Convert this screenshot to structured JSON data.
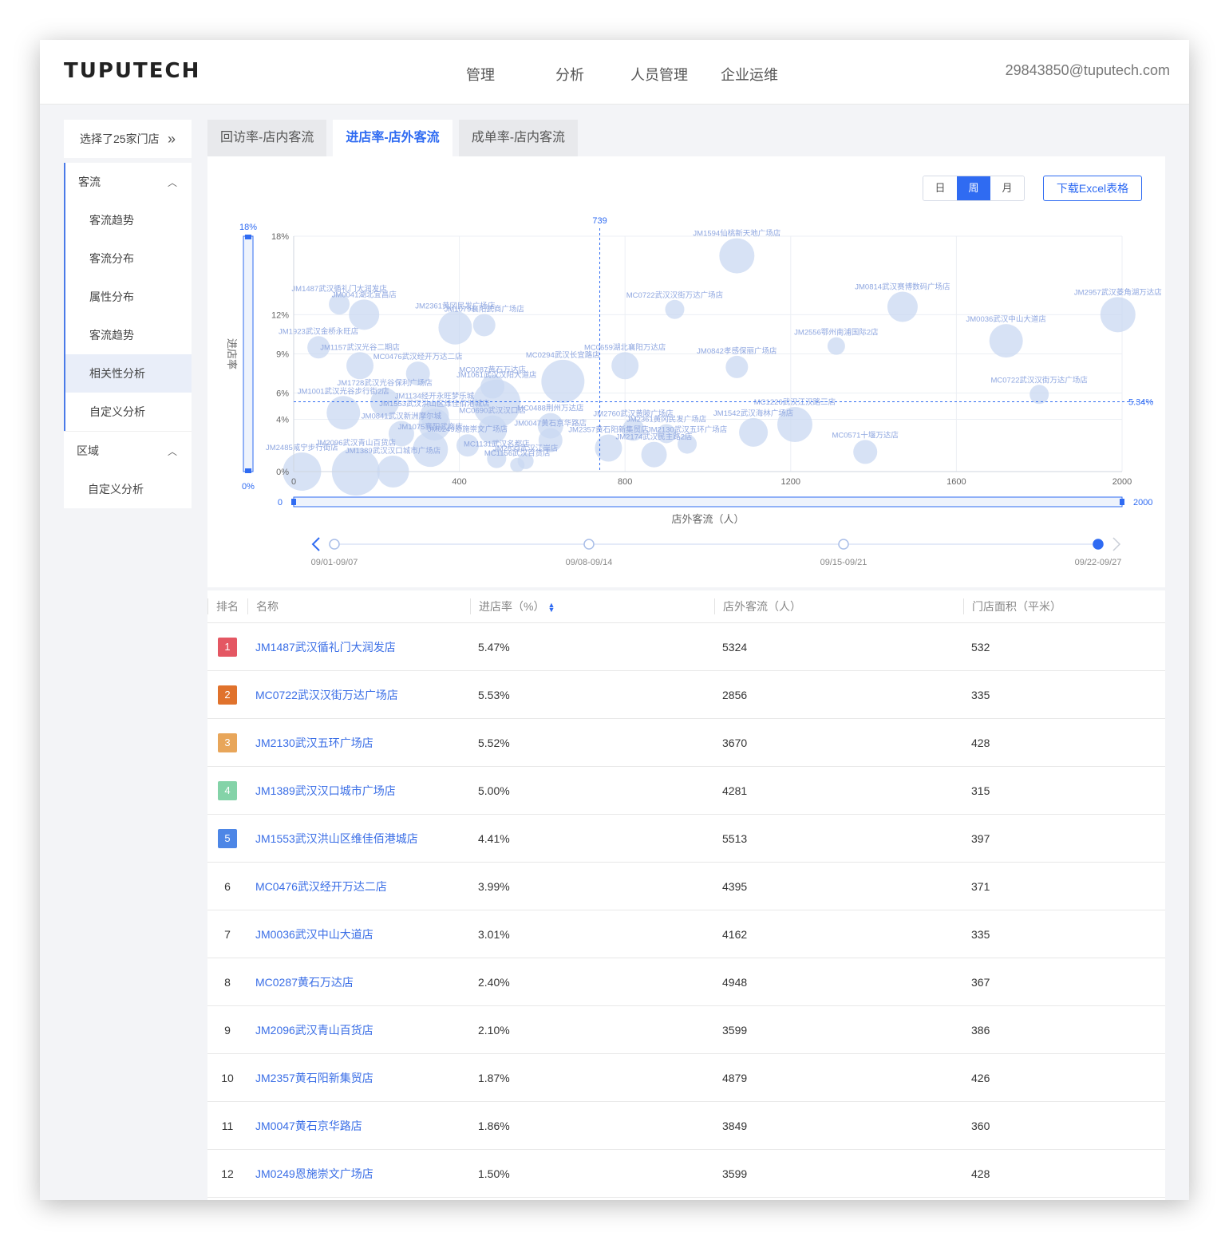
{
  "header": {
    "logo": "TUPUTECH",
    "nav": [
      "管理",
      "分析",
      "人员管理",
      "企业运维"
    ],
    "account": "29843850@tuputech.com"
  },
  "sidebar": {
    "store_select": "选择了25家门店",
    "group1": {
      "title": "客流",
      "items": [
        "客流趋势",
        "客流分布",
        "属性分布",
        "客流趋势",
        "相关性分析",
        "自定义分析"
      ],
      "active_index": 4
    },
    "group2": {
      "title": "区域",
      "items": [
        "自定义分析"
      ]
    }
  },
  "tabs": [
    "回访率-店内客流",
    "进店率-店外客流",
    "成单率-店内客流"
  ],
  "active_tab": 1,
  "periods": [
    "日",
    "周",
    "月"
  ],
  "active_period": "周",
  "download_label": "下载Excel表格",
  "colors": {
    "accent": "#2f6bf2",
    "bubble": "#c9d8f2",
    "label": "#8fa7e0"
  },
  "chart_data": {
    "type": "scatter",
    "xlabel": "店外客流（人）",
    "ylabel": "进店率",
    "xlim": [
      0,
      2000
    ],
    "ylim": [
      0,
      18
    ],
    "x_ticks": [
      "0",
      "400",
      "800",
      "1200",
      "1600",
      "2000"
    ],
    "y_ticks": [
      "0%",
      "4%",
      "6%",
      "9%",
      "12%",
      "18%"
    ],
    "y_tick_values": [
      0,
      4,
      6,
      9,
      12,
      18
    ],
    "mean_x": 739,
    "mean_x_label": "739",
    "mean_y": 5.34,
    "mean_y_label": "5.34%",
    "y_slider": {
      "top": "18%",
      "bottom": "0%"
    },
    "x_slider": {
      "left": "0",
      "right": "2000"
    },
    "points": [
      {
        "name": "JM1594仙桃新天地广场店",
        "x": 1070,
        "y": 16.5,
        "r": 22
      },
      {
        "name": "JM0814武汉赛博数码广场店",
        "x": 1470,
        "y": 12.6,
        "r": 19
      },
      {
        "name": "JM2957武汉菱角湖万达店",
        "x": 1990,
        "y": 12.0,
        "r": 22
      },
      {
        "name": "MC0722武汉汉街万达广场店",
        "x": 920,
        "y": 12.4,
        "r": 12
      },
      {
        "name": "JM1487武汉循礼门大润发店",
        "x": 110,
        "y": 12.8,
        "r": 13
      },
      {
        "name": "JM0041湖北宜昌店",
        "x": 170,
        "y": 12.0,
        "r": 19
      },
      {
        "name": "JM2361黄冈民发广场店",
        "x": 390,
        "y": 11.0,
        "r": 21
      },
      {
        "name": "JM1079襄阳武商广场店",
        "x": 460,
        "y": 11.2,
        "r": 14
      },
      {
        "name": "JM0036武汉中山大道店",
        "x": 1720,
        "y": 10.0,
        "r": 21
      },
      {
        "name": "JM2556鄂州南浦国际2店",
        "x": 1310,
        "y": 9.6,
        "r": 11
      },
      {
        "name": "JM1923武汉金桥永旺店",
        "x": 60,
        "y": 9.5,
        "r": 14
      },
      {
        "name": "JM1157武汉光谷二期店",
        "x": 160,
        "y": 8.1,
        "r": 17
      },
      {
        "name": "MC0659湖北襄阳万达店",
        "x": 800,
        "y": 8.1,
        "r": 17
      },
      {
        "name": "JM0842孝感保丽广场店",
        "x": 1070,
        "y": 8.0,
        "r": 14
      },
      {
        "name": "MC0476武汉经开万达二店",
        "x": 300,
        "y": 7.5,
        "r": 15
      },
      {
        "name": "MC0294武汉长宜路店",
        "x": 650,
        "y": 6.9,
        "r": 27
      },
      {
        "name": "MC0287黄石万达店",
        "x": 480,
        "y": 6.5,
        "r": 15
      },
      {
        "name": "MC0722武汉汉街万达广场店",
        "x": 1800,
        "y": 5.9,
        "r": 12
      },
      {
        "name": "JM1728武汉光谷保利广场店",
        "x": 220,
        "y": 5.3,
        "r": 18
      },
      {
        "name": "JM1061武汉汉阳大道店",
        "x": 490,
        "y": 5.2,
        "r": 30
      },
      {
        "name": "JM1001武汉光谷步行街2店",
        "x": 120,
        "y": 4.5,
        "r": 21
      },
      {
        "name": "JM1134经开永旺梦乐城",
        "x": 340,
        "y": 4.3,
        "r": 18
      },
      {
        "name": "MC1226武汉江汉路三店",
        "x": 1210,
        "y": 3.6,
        "r": 22
      },
      {
        "name": "JM1542武汉海林广场店",
        "x": 1110,
        "y": 3.0,
        "r": 18
      },
      {
        "name": "MC0488荆州万达店",
        "x": 620,
        "y": 3.5,
        "r": 16
      },
      {
        "name": "JM2760武汉黄陂广场店",
        "x": 820,
        "y": 3.2,
        "r": 14
      },
      {
        "name": "JM2361黄冈民发广场店",
        "x": 900,
        "y": 2.9,
        "r": 12
      },
      {
        "name": "JM1553武汉洪山区维佳佰港城店",
        "x": 340,
        "y": 3.6,
        "r": 20
      },
      {
        "name": "MC0690武汉汉口店",
        "x": 480,
        "y": 3.2,
        "r": 18
      },
      {
        "name": "JM0841武汉新洲摩尔城",
        "x": 260,
        "y": 2.9,
        "r": 16
      },
      {
        "name": "JM0047黄石京华路店",
        "x": 620,
        "y": 2.4,
        "r": 15
      },
      {
        "name": "JM2357黄石阳新集贸店",
        "x": 760,
        "y": 1.8,
        "r": 17
      },
      {
        "name": "JM2130武汉五环广场店",
        "x": 950,
        "y": 2.1,
        "r": 12
      },
      {
        "name": "JM2174武汉民主路2店",
        "x": 870,
        "y": 1.3,
        "r": 16
      },
      {
        "name": "MC0571十堰万达店",
        "x": 1380,
        "y": 1.5,
        "r": 15
      },
      {
        "name": "JM2485咸宁步行街店",
        "x": 20,
        "y": 0.0,
        "r": 24
      },
      {
        "name": "JM2096武汉青山百货店",
        "x": 150,
        "y": 0.0,
        "r": 30
      },
      {
        "name": "JM1389武汉汉口城市广场店",
        "x": 240,
        "y": 0.0,
        "r": 20
      },
      {
        "name": "JM1075襄阳武商店",
        "x": 330,
        "y": 1.7,
        "r": 22
      },
      {
        "name": "JM0249恩施崇文广场店",
        "x": 420,
        "y": 2.0,
        "r": 14
      },
      {
        "name": "MC1131武汉名都店",
        "x": 490,
        "y": 1.0,
        "r": 12
      },
      {
        "name": "JM2833武汉江岸店",
        "x": 560,
        "y": 0.8,
        "r": 10
      },
      {
        "name": "MC1156武汉百货店",
        "x": 540,
        "y": 0.5,
        "r": 9
      }
    ]
  },
  "timeline": {
    "labels": [
      "09/01-09/07",
      "09/08-09/14",
      "09/15-09/21",
      "09/22-09/27"
    ],
    "active_index": 3
  },
  "table": {
    "headers": [
      "排名",
      "名称",
      "进店率（%）",
      "店外客流（人）",
      "门店面积（平米）"
    ],
    "rows": [
      {
        "rank": "1",
        "name": "JM1487武汉循礼门大润发店",
        "rate": "5.47%",
        "flow": "5324",
        "area": "532",
        "badge": "#e45763"
      },
      {
        "rank": "2",
        "name": "MC0722武汉汉街万达广场店",
        "rate": "5.53%",
        "flow": "2856",
        "area": "335",
        "badge": "#e0722c"
      },
      {
        "rank": "3",
        "name": "JM2130武汉五环广场店",
        "rate": "5.52%",
        "flow": "3670",
        "area": "428",
        "badge": "#e8a65a"
      },
      {
        "rank": "4",
        "name": "JM1389武汉汉口城市广场店",
        "rate": "5.00%",
        "flow": "4281",
        "area": "315",
        "badge": "#84d3a8"
      },
      {
        "rank": "5",
        "name": "JM1553武汉洪山区维佳佰港城店",
        "rate": "4.41%",
        "flow": "5513",
        "area": "397",
        "badge": "#4d86e6"
      },
      {
        "rank": "6",
        "name": "MC0476武汉经开万达二店",
        "rate": "3.99%",
        "flow": "4395",
        "area": "371"
      },
      {
        "rank": "7",
        "name": "JM0036武汉中山大道店",
        "rate": "3.01%",
        "flow": "4162",
        "area": "335"
      },
      {
        "rank": "8",
        "name": "MC0287黄石万达店",
        "rate": "2.40%",
        "flow": "4948",
        "area": "367"
      },
      {
        "rank": "9",
        "name": "JM2096武汉青山百货店",
        "rate": "2.10%",
        "flow": "3599",
        "area": "386"
      },
      {
        "rank": "10",
        "name": "JM2357黄石阳新集贸店",
        "rate": "1.87%",
        "flow": "4879",
        "area": "426"
      },
      {
        "rank": "11",
        "name": "JM0047黄石京华路店",
        "rate": "1.86%",
        "flow": "3849",
        "area": "360"
      },
      {
        "rank": "12",
        "name": "JM0249恩施崇文广场店",
        "rate": "1.50%",
        "flow": "3599",
        "area": "428"
      }
    ]
  }
}
